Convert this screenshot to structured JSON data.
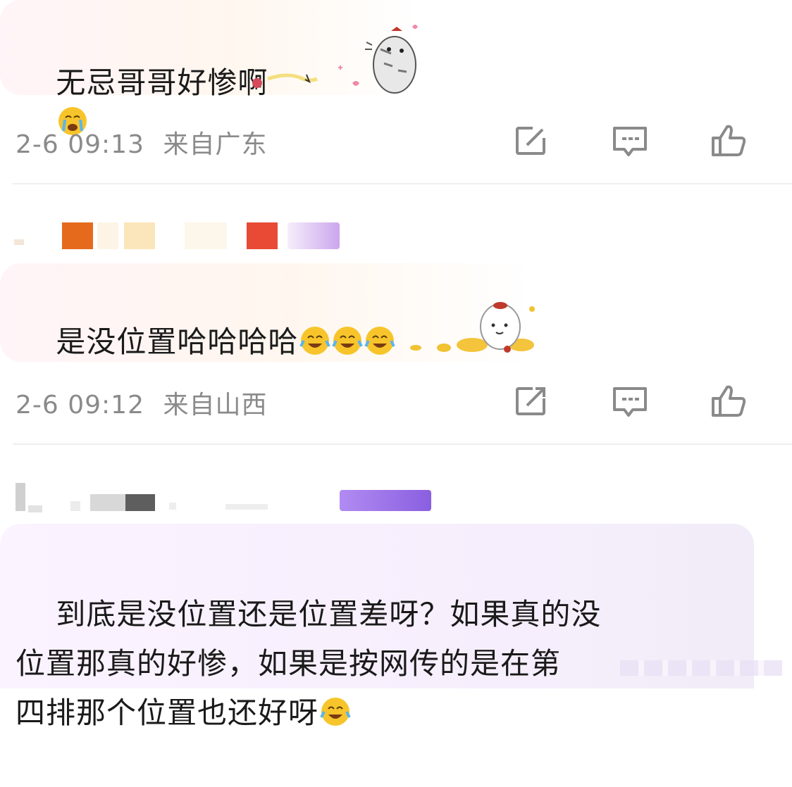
{
  "comments": [
    {
      "text": "无忌哥哥好惨啊",
      "time": "2-6 09:13",
      "location": "来自广东",
      "emoji": [
        "crying-face"
      ],
      "sticker": "cat-sticker"
    },
    {
      "text": "是没位置哈哈哈哈",
      "time": "2-6 09:12",
      "location": "来自山西",
      "emoji": [
        "laughing-crying-face",
        "laughing-crying-face",
        "laughing-crying-face"
      ],
      "sticker": "mascot-gold-sticker"
    },
    {
      "text": "到底是没位置还是位置差呀？如果真的没\n位置那真的好惨，如果是按网传的是在第\n四排那个位置也还好呀",
      "emoji": [
        "laughing-crying-face"
      ]
    }
  ],
  "actions": [
    "share-icon",
    "comment-icon",
    "like-icon"
  ],
  "colors": {
    "meta_text": "#8a8a8a",
    "icon_stroke": "#8a8a8a",
    "divider": "#efefef",
    "emoji_yellow": "#f7c52b"
  }
}
